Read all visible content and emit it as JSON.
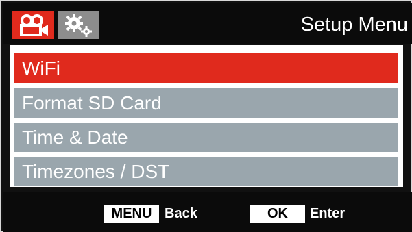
{
  "header": {
    "title": "Setup Menu",
    "tabs": [
      {
        "icon": "video-camera-icon",
        "active": true
      },
      {
        "icon": "gears-icon",
        "active": false
      }
    ]
  },
  "menu": {
    "items": [
      {
        "label": "WiFi",
        "selected": true
      },
      {
        "label": "Format SD Card",
        "selected": false
      },
      {
        "label": "Time & Date",
        "selected": false
      },
      {
        "label": "Timezones / DST",
        "selected": false
      }
    ]
  },
  "footer": {
    "menu_key": "MENU",
    "menu_action": "Back",
    "ok_key": "OK",
    "ok_action": "Enter"
  },
  "colors": {
    "accent": "#e02a1d",
    "inactive_item": "#9aa6ad",
    "background": "#0b0b0b"
  }
}
